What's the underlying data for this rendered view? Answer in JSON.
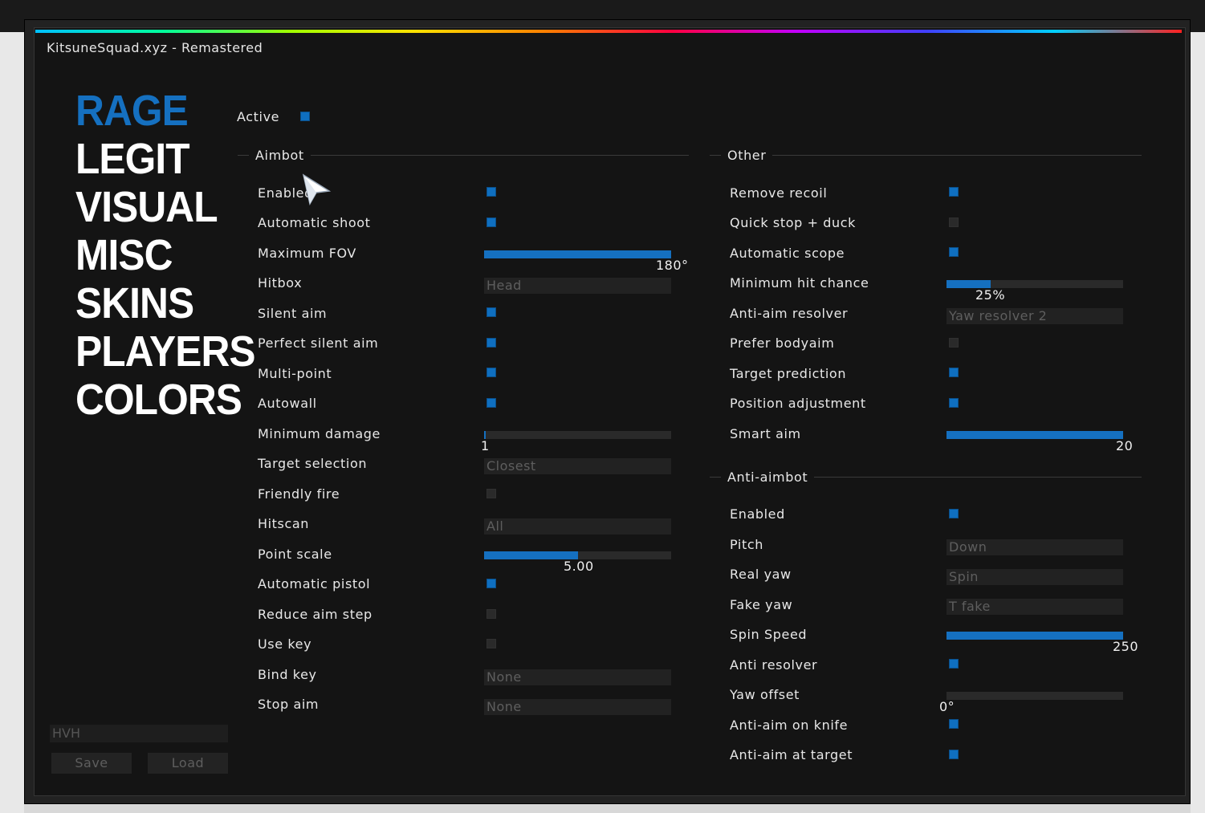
{
  "window": {
    "title": "KitsuneSquad.xyz - Remastered"
  },
  "nav": {
    "items": [
      "RAGE",
      "LEGIT",
      "VISUAL",
      "MISC",
      "SKINS",
      "PLAYERS",
      "COLORS"
    ]
  },
  "active": {
    "label": "Active",
    "checked": true
  },
  "aimbot": {
    "title": "Aimbot",
    "enabled": {
      "label": "Enabled",
      "checked": true
    },
    "automatic_shoot": {
      "label": "Automatic shoot",
      "checked": true
    },
    "maximum_fov": {
      "label": "Maximum FOV",
      "value": "180°",
      "level": 1.0
    },
    "hitbox": {
      "label": "Hitbox",
      "value": "Head"
    },
    "silent_aim": {
      "label": "Silent aim",
      "checked": true
    },
    "perfect_silent_aim": {
      "label": "Perfect silent aim",
      "checked": true
    },
    "multi_point": {
      "label": "Multi-point",
      "checked": true
    },
    "autowall": {
      "label": "Autowall",
      "checked": true
    },
    "minimum_damage": {
      "label": "Minimum damage",
      "value": "1",
      "level": 0.01
    },
    "target_selection": {
      "label": "Target selection",
      "value": "Closest"
    },
    "friendly_fire": {
      "label": "Friendly fire",
      "checked": false
    },
    "hitscan": {
      "label": "Hitscan",
      "value": "All"
    },
    "point_scale": {
      "label": "Point scale",
      "value": "5.00",
      "level": 0.5
    },
    "automatic_pistol": {
      "label": "Automatic pistol",
      "checked": true
    },
    "reduce_aim_step": {
      "label": "Reduce aim step",
      "checked": false
    },
    "use_key": {
      "label": "Use key",
      "checked": false
    },
    "bind_key": {
      "label": "Bind key",
      "value": "None"
    },
    "stop_aim": {
      "label": "Stop aim",
      "value": "None"
    }
  },
  "other": {
    "title": "Other",
    "remove_recoil": {
      "label": "Remove recoil",
      "checked": true
    },
    "quick_stop_duck": {
      "label": "Quick stop + duck",
      "checked": false
    },
    "automatic_scope": {
      "label": "Automatic scope",
      "checked": true
    },
    "minimum_hit_chance": {
      "label": "Minimum hit chance",
      "value": "25%",
      "level": 0.25
    },
    "anti_aim_resolver": {
      "label": "Anti-aim resolver",
      "value": "Yaw resolver 2"
    },
    "prefer_bodyaim": {
      "label": "Prefer bodyaim",
      "checked": false
    },
    "target_prediction": {
      "label": "Target prediction",
      "checked": true
    },
    "position_adjustment": {
      "label": "Position adjustment",
      "checked": true
    },
    "smart_aim": {
      "label": "Smart aim",
      "value": "20",
      "level": 1.0
    }
  },
  "anti_aimbot": {
    "title": "Anti-aimbot",
    "enabled": {
      "label": "Enabled",
      "checked": true
    },
    "pitch": {
      "label": "Pitch",
      "value": "Down"
    },
    "real_yaw": {
      "label": "Real yaw",
      "value": "Spin"
    },
    "fake_yaw": {
      "label": "Fake yaw",
      "value": "T fake"
    },
    "spin_speed": {
      "label": "Spin Speed",
      "value": "250",
      "level": 1.0
    },
    "anti_resolver": {
      "label": "Anti resolver",
      "checked": true
    },
    "yaw_offset": {
      "label": "Yaw offset",
      "value": "0°",
      "level": 0.0
    },
    "anti_aim_on_knife": {
      "label": "Anti-aim on knife",
      "checked": true
    },
    "anti_aim_at_target": {
      "label": "Anti-aim at target",
      "checked": true
    }
  },
  "config": {
    "name": "HVH",
    "save_label": "Save",
    "load_label": "Load"
  },
  "colors": {
    "accent": "#1570c0",
    "background": "#141414",
    "text": "#e8e8e8",
    "disabled_text": "#5e5e5e"
  }
}
